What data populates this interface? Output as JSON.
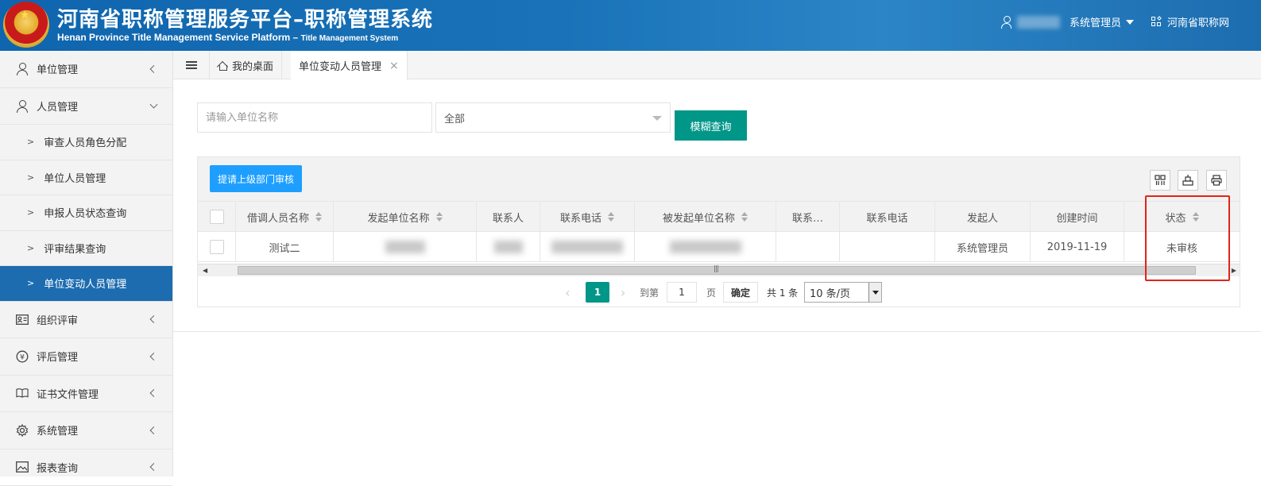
{
  "header": {
    "title_cn": "河南省职称管理服务平台–职称管理系统",
    "title_en": "Henan Province Title Management Service Platform –",
    "title_en_sub": "Title Management System",
    "user_role": "系统管理员",
    "site_link": "河南省职称网"
  },
  "sidebar": {
    "items": [
      {
        "label": "单位管理",
        "icon": "person-icon"
      },
      {
        "label": "人员管理",
        "icon": "person-icon"
      }
    ],
    "sub_items": [
      {
        "label": "审查人员角色分配"
      },
      {
        "label": "单位人员管理"
      },
      {
        "label": "申报人员状态查询"
      },
      {
        "label": "评审结果查询"
      },
      {
        "label": "单位变动人员管理"
      }
    ],
    "lower_items": [
      {
        "label": "组织评审",
        "icon": "id-card-icon"
      },
      {
        "label": "评后管理",
        "icon": "coin-icon"
      },
      {
        "label": "证书文件管理",
        "icon": "book-icon"
      },
      {
        "label": "系统管理",
        "icon": "gear-icon"
      },
      {
        "label": "报表查询",
        "icon": "image-icon"
      }
    ]
  },
  "tabs": [
    {
      "label": "我的桌面"
    },
    {
      "label": "单位变动人员管理"
    }
  ],
  "filter": {
    "search_placeholder": "请输入单位名称",
    "select_value": "全部",
    "query_button": "模糊查询"
  },
  "toolbar": {
    "submit_button": "提请上级部门审核"
  },
  "table": {
    "columns": [
      "借调人员名称",
      "发起单位名称",
      "联系人",
      "联系电话",
      "被发起单位名称",
      "联系…",
      "联系电话",
      "发起人",
      "创建时间",
      "状态"
    ],
    "rows": [
      {
        "name": "测试二",
        "initiator": "系统管理员",
        "created": "2019-11-19",
        "status": "未审核"
      }
    ]
  },
  "pager": {
    "current": "1",
    "goto_label": "到第",
    "page_input": "1",
    "page_unit": "页",
    "confirm": "确定",
    "total": "共 1 条",
    "page_size": "10 条/页"
  }
}
